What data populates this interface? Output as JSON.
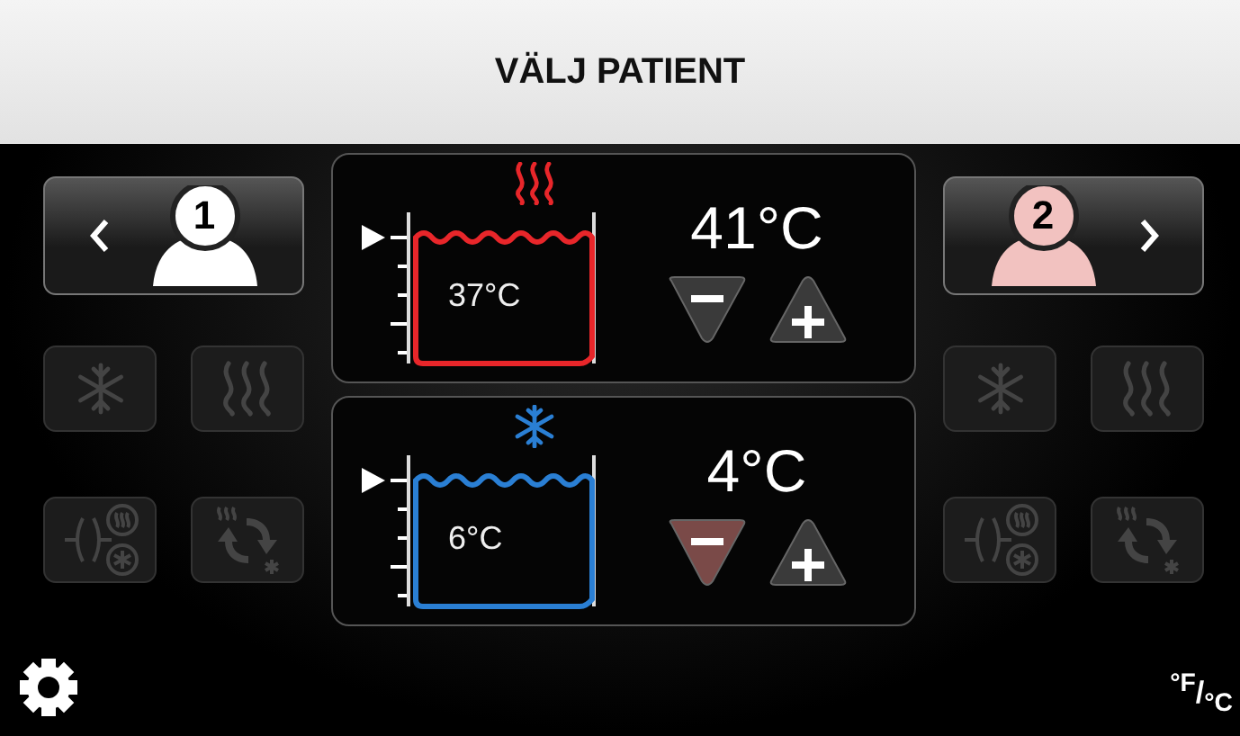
{
  "header": {
    "title": "VÄLJ PATIENT"
  },
  "patients": [
    {
      "number": "1",
      "kind": "previous",
      "selected": true,
      "modes": [
        {
          "kind": "cool",
          "disabled": true
        },
        {
          "kind": "heat",
          "disabled": true
        },
        {
          "kind": "pulse",
          "disabled": true
        },
        {
          "kind": "cycle",
          "disabled": true
        }
      ]
    },
    {
      "number": "2",
      "kind": "next",
      "selected": false,
      "modes": [
        {
          "kind": "cool",
          "disabled": true
        },
        {
          "kind": "heat",
          "disabled": true
        },
        {
          "kind": "pulse",
          "disabled": true
        },
        {
          "kind": "cycle",
          "disabled": true
        }
      ]
    }
  ],
  "baths": [
    {
      "kind": "heat",
      "color": "#e8262a",
      "current": "37°C",
      "setpoint": "41°C",
      "minus_pressed": false
    },
    {
      "kind": "cool",
      "color": "#2a7fd4",
      "current": "6°C",
      "setpoint": "4°C",
      "minus_pressed": true
    }
  ],
  "units": "$^{°F}$/$_{°C}$"
}
